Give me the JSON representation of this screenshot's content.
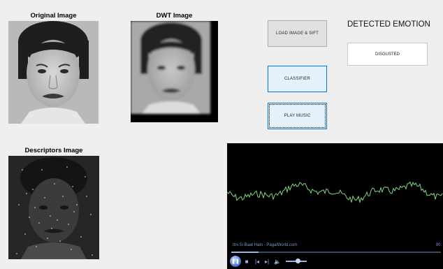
{
  "panels": {
    "original_label": "Original Image",
    "dwt_label": "DWT Image",
    "descriptors_label": "Descriptors Image"
  },
  "buttons": {
    "load": "LOAD IMAGE & SIFT",
    "classifier": "CLASSIFIER",
    "play_music": "PLAY MUSIC"
  },
  "emotion": {
    "title": "DETECTED EMOTION",
    "value": "DISGUSTED"
  },
  "player": {
    "track": "Itni Si Baat Hain - PagalWorld.com",
    "time": "00:",
    "seek_progress": 0.13,
    "volume": 0.55,
    "waveform_color": "#7fd67f"
  },
  "icons": {
    "play": "pause-icon",
    "stop": "stop-icon",
    "prev": "previous-icon",
    "next": "next-icon",
    "mute": "speaker-icon"
  }
}
